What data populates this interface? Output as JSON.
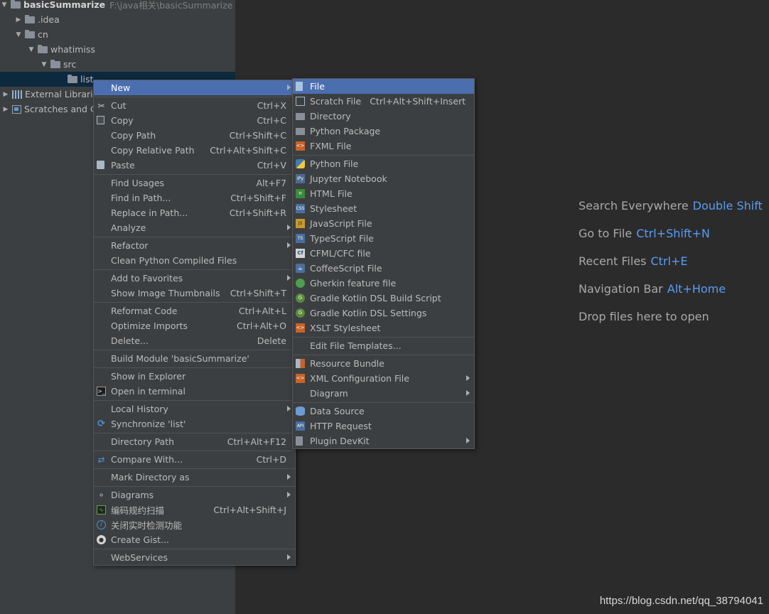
{
  "project_tree": {
    "root": {
      "name": "basicSummarize",
      "path": "F:\\java相关\\basicSummarize"
    },
    "items": [
      {
        "label": ".idea"
      },
      {
        "label": "cn"
      },
      {
        "label": "whatimiss"
      },
      {
        "label": "src"
      },
      {
        "label": "list"
      },
      {
        "label": "External Librarie"
      },
      {
        "label": "Scratches and C"
      }
    ]
  },
  "context_menu": {
    "items": [
      {
        "label": "New"
      },
      {
        "label": "Cut",
        "shortcut": "Ctrl+X"
      },
      {
        "label": "Copy",
        "shortcut": "Ctrl+C"
      },
      {
        "label": "Copy Path",
        "shortcut": "Ctrl+Shift+C"
      },
      {
        "label": "Copy Relative Path",
        "shortcut": "Ctrl+Alt+Shift+C"
      },
      {
        "label": "Paste",
        "shortcut": "Ctrl+V"
      },
      {
        "label": "Find Usages",
        "shortcut": "Alt+F7"
      },
      {
        "label": "Find in Path...",
        "shortcut": "Ctrl+Shift+F"
      },
      {
        "label": "Replace in Path...",
        "shortcut": "Ctrl+Shift+R"
      },
      {
        "label": "Analyze"
      },
      {
        "label": "Refactor"
      },
      {
        "label": "Clean Python Compiled Files"
      },
      {
        "label": "Add to Favorites"
      },
      {
        "label": "Show Image Thumbnails",
        "shortcut": "Ctrl+Shift+T"
      },
      {
        "label": "Reformat Code",
        "shortcut": "Ctrl+Alt+L"
      },
      {
        "label": "Optimize Imports",
        "shortcut": "Ctrl+Alt+O"
      },
      {
        "label": "Delete...",
        "shortcut": "Delete"
      },
      {
        "label": "Build Module 'basicSummarize'"
      },
      {
        "label": "Show in Explorer"
      },
      {
        "label": "Open in terminal"
      },
      {
        "label": "Local History"
      },
      {
        "label": "Synchronize 'list'"
      },
      {
        "label": "Directory Path",
        "shortcut": "Ctrl+Alt+F12"
      },
      {
        "label": "Compare With...",
        "shortcut": "Ctrl+D"
      },
      {
        "label": "Mark Directory as"
      },
      {
        "label": "Diagrams"
      },
      {
        "label": "编码规约扫描",
        "shortcut": "Ctrl+Alt+Shift+J"
      },
      {
        "label": "关闭实时检测功能"
      },
      {
        "label": "Create Gist..."
      },
      {
        "label": "WebServices"
      }
    ]
  },
  "new_submenu": {
    "items": [
      {
        "label": "File"
      },
      {
        "label": "Scratch File",
        "shortcut": "Ctrl+Alt+Shift+Insert"
      },
      {
        "label": "Directory"
      },
      {
        "label": "Python Package"
      },
      {
        "label": "FXML File"
      },
      {
        "label": "Python File"
      },
      {
        "label": "Jupyter Notebook"
      },
      {
        "label": "HTML File"
      },
      {
        "label": "Stylesheet"
      },
      {
        "label": "JavaScript File"
      },
      {
        "label": "TypeScript File"
      },
      {
        "label": "CFML/CFC file"
      },
      {
        "label": "CoffeeScript File"
      },
      {
        "label": "Gherkin feature file"
      },
      {
        "label": "Gradle Kotlin DSL Build Script"
      },
      {
        "label": "Gradle Kotlin DSL Settings"
      },
      {
        "label": "XSLT Stylesheet"
      },
      {
        "label": "Edit File Templates..."
      },
      {
        "label": "Resource Bundle"
      },
      {
        "label": "XML Configuration File"
      },
      {
        "label": "Diagram"
      },
      {
        "label": "Data Source"
      },
      {
        "label": "HTTP Request"
      },
      {
        "label": "Plugin DevKit"
      }
    ]
  },
  "editor_hints": [
    {
      "text": "Search Everywhere",
      "key": "Double Shift"
    },
    {
      "text": "Go to File",
      "key": "Ctrl+Shift+N"
    },
    {
      "text": "Recent Files",
      "key": "Ctrl+E"
    },
    {
      "text": "Navigation Bar",
      "key": "Alt+Home"
    },
    {
      "text": "Drop files here to open",
      "key": ""
    }
  ],
  "watermark": "https://blog.csdn.net/qq_38794041",
  "colors": {
    "highlight": "#4b6eaf",
    "shortcut_hint": "#589df6",
    "panel": "#3c3f41",
    "editor": "#2b2b2b"
  }
}
